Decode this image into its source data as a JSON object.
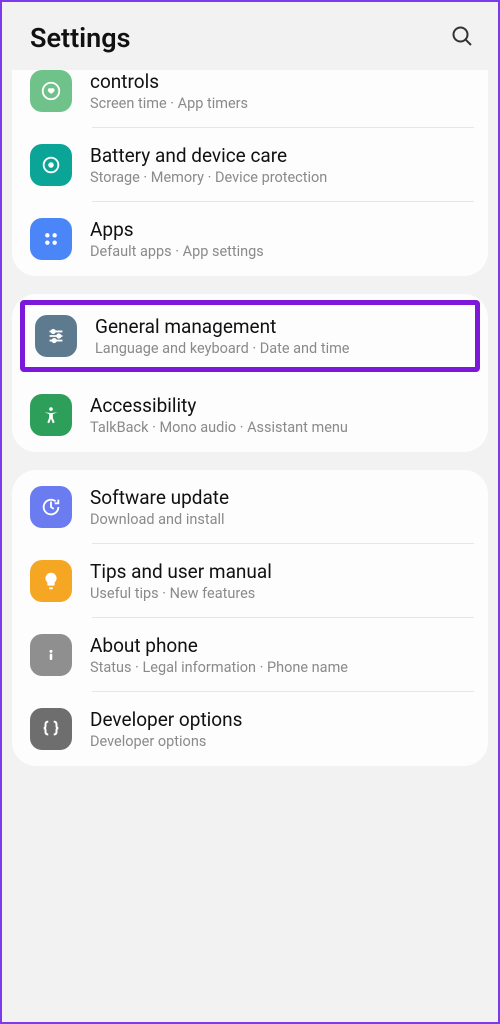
{
  "header": {
    "title": "Settings"
  },
  "groups": [
    {
      "items": [
        {
          "icon": "heart",
          "bg": "bg-green1",
          "title": "controls",
          "sub": "Screen time  ·  App timers"
        },
        {
          "icon": "care",
          "bg": "bg-teal",
          "title": "Battery and device care",
          "sub": "Storage  ·  Memory  ·  Device protection"
        },
        {
          "icon": "apps",
          "bg": "bg-blue",
          "title": "Apps",
          "sub": "Default apps  ·  App settings"
        }
      ]
    },
    {
      "items": [
        {
          "icon": "sliders",
          "bg": "bg-bluegray",
          "title": "General management",
          "sub": "Language and keyboard  ·  Date and time",
          "highlighted": true
        },
        {
          "icon": "accessibility",
          "bg": "bg-green2",
          "title": "Accessibility",
          "sub": "TalkBack  ·  Mono audio  ·  Assistant menu"
        }
      ]
    },
    {
      "items": [
        {
          "icon": "update",
          "bg": "bg-purple",
          "title": "Software update",
          "sub": "Download and install"
        },
        {
          "icon": "tips",
          "bg": "bg-orange",
          "title": "Tips and user manual",
          "sub": "Useful tips  ·  New features"
        },
        {
          "icon": "info",
          "bg": "bg-gray",
          "title": "About phone",
          "sub": "Status  ·  Legal information  ·  Phone name"
        },
        {
          "icon": "dev",
          "bg": "bg-darkgray",
          "title": "Developer options",
          "sub": "Developer options"
        }
      ]
    }
  ]
}
